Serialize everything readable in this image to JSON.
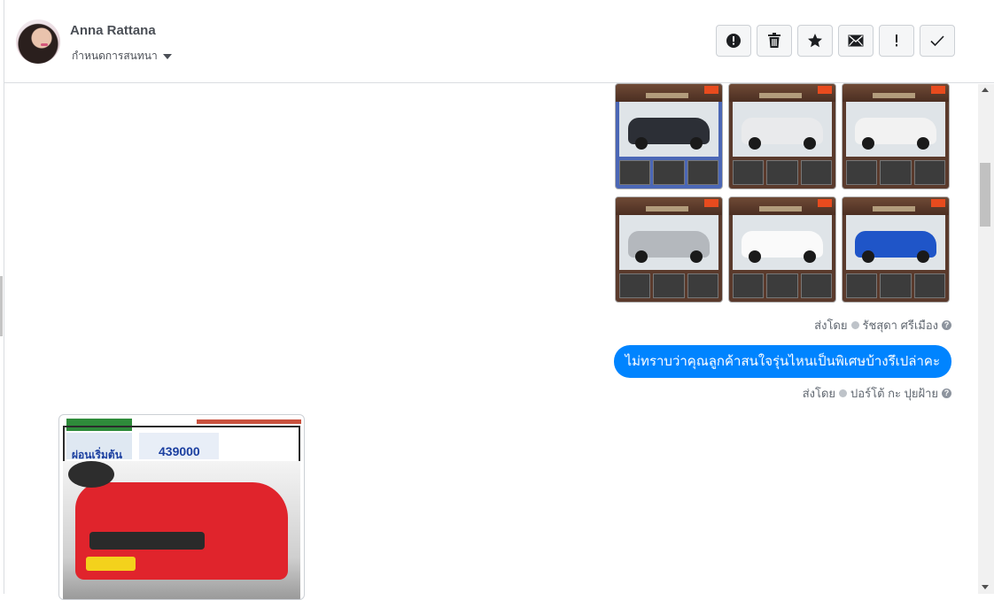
{
  "header": {
    "name": "Anna Rattana",
    "conversation_setting": "กำหนดการสนทนา",
    "actions": [
      {
        "name": "spam-icon",
        "label": "Mark as spam"
      },
      {
        "name": "trash-icon",
        "label": "Delete"
      },
      {
        "name": "star-icon",
        "label": "Star"
      },
      {
        "name": "envelope-icon",
        "label": "Mark as unread"
      },
      {
        "name": "exclamation-icon",
        "label": "Important"
      },
      {
        "name": "check-icon",
        "label": "Done"
      }
    ]
  },
  "messages": {
    "image_grid_sent_by_label": "ส่งโดย",
    "image_grid_sender": "รัชสุดา ศรีเมือง",
    "text_message": "ไม่ทราบว่าคุณลูกค้าสนใจรุ่นไหนเป็นพิเศษบ้างรึเปล่าคะ",
    "text_sent_by_label": "ส่งโดย",
    "text_sender": "ปอร์โต้ กะ ปุยฝ้าย",
    "help_glyph": "?",
    "incoming_image": {
      "starting_label": "ผ่อนเริ่มต้น",
      "price": "439000"
    }
  },
  "colors": {
    "bubble": "#0084ff",
    "header_border": "#dadde1"
  }
}
